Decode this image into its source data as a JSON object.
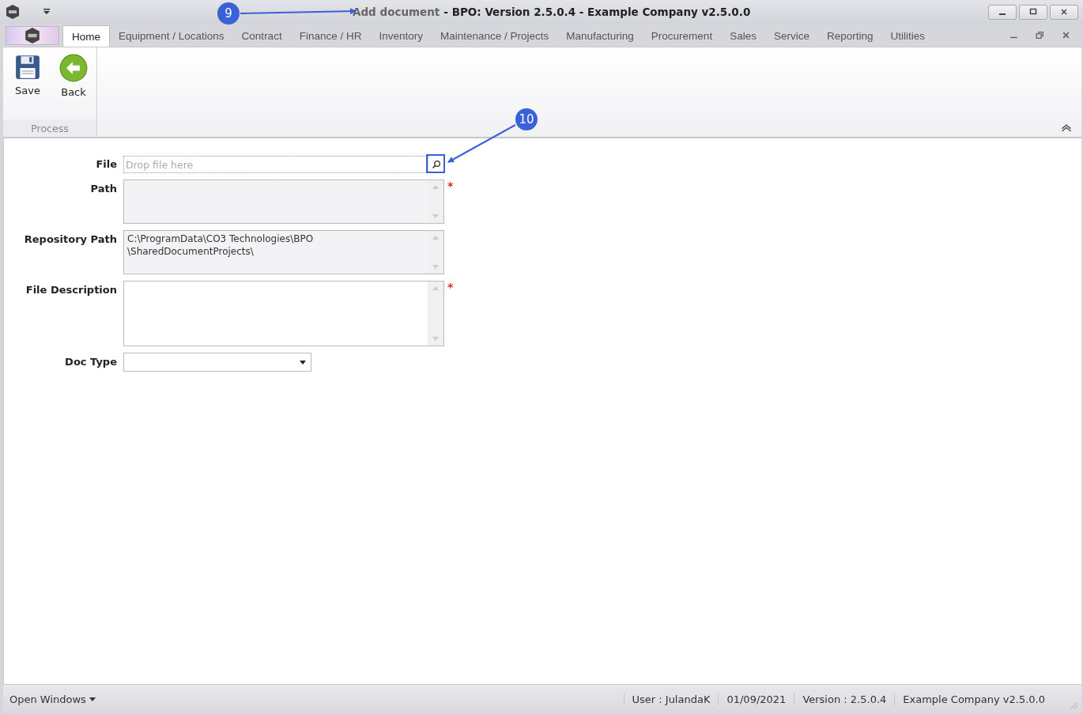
{
  "window": {
    "title_document": "Add document",
    "title_app": "- BPO: Version 2.5.0.4 - Example Company v2.5.0.0"
  },
  "tabs": [
    {
      "label": "Home",
      "selected": true
    },
    {
      "label": "Equipment / Locations",
      "selected": false
    },
    {
      "label": "Contract",
      "selected": false
    },
    {
      "label": "Finance / HR",
      "selected": false
    },
    {
      "label": "Inventory",
      "selected": false
    },
    {
      "label": "Maintenance / Projects",
      "selected": false
    },
    {
      "label": "Manufacturing",
      "selected": false
    },
    {
      "label": "Procurement",
      "selected": false
    },
    {
      "label": "Sales",
      "selected": false
    },
    {
      "label": "Service",
      "selected": false
    },
    {
      "label": "Reporting",
      "selected": false
    },
    {
      "label": "Utilities",
      "selected": false
    }
  ],
  "ribbon": {
    "group": "Process",
    "buttons": [
      {
        "label": "Save",
        "kind": "save"
      },
      {
        "label": "Back",
        "kind": "back"
      }
    ]
  },
  "form": [
    {
      "label": "File",
      "kind": "file",
      "placeholder": "Drop file here"
    },
    {
      "label": "Path",
      "kind": "textarea",
      "required_mark": "*",
      "readonly": true,
      "tall": false
    },
    {
      "label": "Repository Path",
      "kind": "textarea",
      "value": "C:\\ProgramData\\CO3 Technologies\\BPO\n\\SharedDocumentProjects\\",
      "readonly": true,
      "tall": false
    },
    {
      "label": "File Description",
      "kind": "textarea",
      "required_mark": "*",
      "readonly": false,
      "tall": true
    },
    {
      "label": "Doc Type",
      "kind": "dropdown"
    }
  ],
  "callouts": [
    {
      "number": "9"
    },
    {
      "number": "10"
    }
  ],
  "status_bar": {
    "menu": "Open Windows",
    "items": [
      "User : JulandaK",
      "01/09/2021",
      "Version : 2.5.0.4",
      "Example Company v2.5.0.0"
    ]
  }
}
